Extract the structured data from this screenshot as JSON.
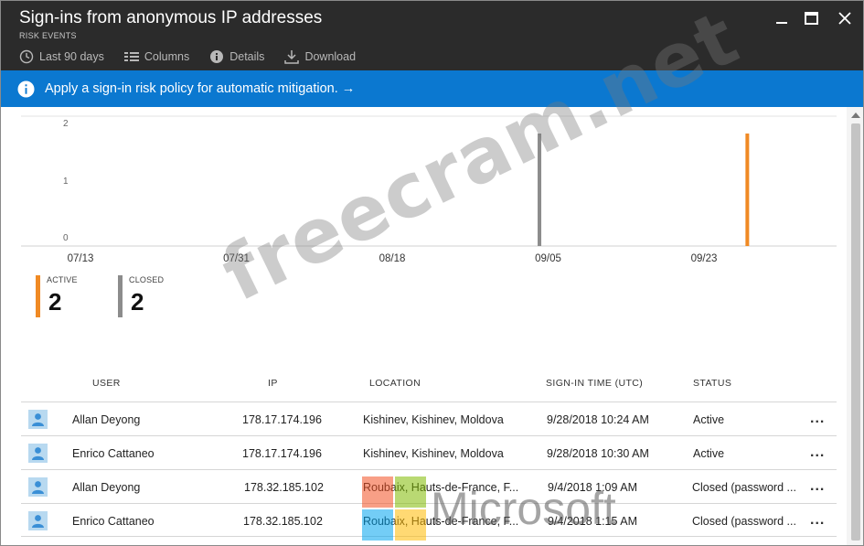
{
  "window": {
    "title": "Sign-ins from anonymous IP addresses",
    "subtitle": "RISK EVENTS"
  },
  "toolbar": {
    "items": [
      {
        "label": "Last 90 days",
        "icon": "clock-icon"
      },
      {
        "label": "Columns",
        "icon": "columns-icon"
      },
      {
        "label": "Details",
        "icon": "info-icon"
      },
      {
        "label": "Download",
        "icon": "download-icon"
      }
    ]
  },
  "banner": {
    "text": "Apply a sign-in risk policy for automatic mitigation. →"
  },
  "chart_data": {
    "type": "bar",
    "x_tick_labels": [
      "07/13",
      "07/31",
      "08/18",
      "09/05",
      "09/23"
    ],
    "y_tick_labels": [
      "2",
      "1",
      "0"
    ],
    "ylim": [
      0,
      2
    ],
    "series": [
      {
        "name": "CLOSED",
        "color": "#8c8c8c",
        "points": [
          {
            "x": "2018-09-04",
            "y": 2
          }
        ]
      },
      {
        "name": "ACTIVE",
        "color": "#f08a24",
        "points": [
          {
            "x": "2018-09-28",
            "y": 2
          }
        ]
      }
    ]
  },
  "counters": {
    "active": {
      "label": "ACTIVE",
      "value": "2",
      "color": "#f08a24"
    },
    "closed": {
      "label": "CLOSED",
      "value": "2",
      "color": "#8c8c8c"
    }
  },
  "table": {
    "headers": {
      "user": "USER",
      "ip": "IP",
      "location": "LOCATION",
      "time": "SIGN-IN TIME (UTC)",
      "status": "STATUS"
    },
    "rows": [
      {
        "user": "Allan Deyong",
        "ip": "178.17.174.196",
        "location": "Kishinev, Kishinev, Moldova",
        "time": "9/28/2018 10:24 AM",
        "status": "Active"
      },
      {
        "user": "Enrico Cattaneo",
        "ip": "178.17.174.196",
        "location": "Kishinev, Kishinev, Moldova",
        "time": "9/28/2018 10:30 AM",
        "status": "Active"
      },
      {
        "user": "Allan Deyong",
        "ip": "178.32.185.102",
        "location": "Roubaix, Hauts-de-France, F...",
        "time": "9/4/2018 1:09 AM",
        "status": "Closed (password ..."
      },
      {
        "user": "Enrico Cattaneo",
        "ip": "178.32.185.102",
        "location": "Roubaix, Hauts-de-France, F...",
        "time": "9/4/2018 1:15 AM",
        "status": "Closed (password ..."
      }
    ],
    "more_label": "..."
  },
  "watermarks": {
    "text": "freecram.net",
    "brand": "Microsoft"
  },
  "colors": {
    "titlebar": "#2b2b2b",
    "banner": "#0b78d0",
    "active": "#f08a24",
    "closed": "#8c8c8c"
  }
}
